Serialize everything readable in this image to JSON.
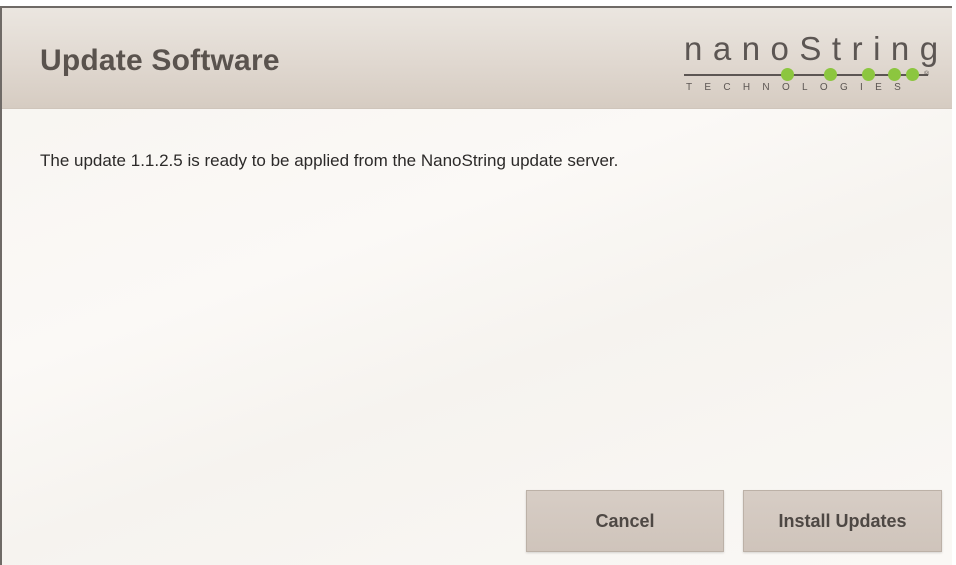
{
  "dialog": {
    "title": "Update Software",
    "message": "The update 1.1.2.5 is ready to be applied from the NanoString update server."
  },
  "logo": {
    "word": "nanoString",
    "subtitle": "TECHNOLOGIES",
    "registered": "®",
    "accent_color": "#8cc63f"
  },
  "buttons": {
    "cancel_label": "Cancel",
    "install_label": "Install Updates"
  }
}
